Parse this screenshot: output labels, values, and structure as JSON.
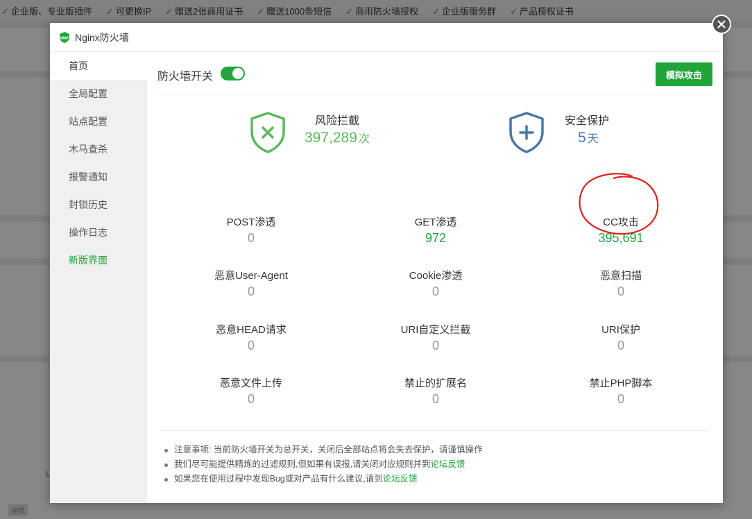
{
  "topbar": {
    "perks": [
      "企业版、专业版插件",
      "可更换IP",
      "赠送2张商用证书",
      "赠送1000条短信",
      "商用防火墙授权",
      "企业版服务群",
      "产品授权证书"
    ]
  },
  "background": {
    "side_letter": "L",
    "bottom_label": "推荐"
  },
  "modal": {
    "title": "Nginx防火墙",
    "logo_text": "WAF"
  },
  "sidebar": {
    "items": [
      {
        "label": "首页"
      },
      {
        "label": "全局配置"
      },
      {
        "label": "站点配置"
      },
      {
        "label": "木马查杀"
      },
      {
        "label": "报警通知"
      },
      {
        "label": "封锁历史"
      },
      {
        "label": "操作日志"
      },
      {
        "label": "新版界面"
      }
    ]
  },
  "toolbar": {
    "switch_label": "防火墙开关",
    "switch_on": true,
    "simulate_button": "模拟攻击"
  },
  "summary": {
    "risk": {
      "label": "风险拦截",
      "value": "397,289",
      "unit": "次"
    },
    "safe": {
      "label": "安全保护",
      "value": "5",
      "unit": "天"
    }
  },
  "stats": [
    {
      "label": "POST渗透",
      "value": "0"
    },
    {
      "label": "GET渗透",
      "value": "972"
    },
    {
      "label": "CC攻击",
      "value": "395,691"
    },
    {
      "label": "恶意User-Agent",
      "value": "0"
    },
    {
      "label": "Cookie渗透",
      "value": "0"
    },
    {
      "label": "恶意扫描",
      "value": "0"
    },
    {
      "label": "恶意HEAD请求",
      "value": "0"
    },
    {
      "label": "URI自定义拦截",
      "value": "0"
    },
    {
      "label": "URI保护",
      "value": "0"
    },
    {
      "label": "恶意文件上传",
      "value": "0"
    },
    {
      "label": "禁止的扩展名",
      "value": "0"
    },
    {
      "label": "禁止PHP脚本",
      "value": "0"
    }
  ],
  "notes": {
    "n1": "注意事项: 当前防火墙开关为总开关，关闭后全部站点将会失去保护，请谨慎操作",
    "n2": "我们尽可能提供精炼的过滤规则,但如果有误报,请关闭对应规则并到",
    "n2_link": "论坛反馈",
    "n3": "如果您在使用过程中发现Bug或对产品有什么建议,请到",
    "n3_link": "论坛反馈"
  },
  "colors": {
    "accent": "#20a53a",
    "safe_blue": "#4a78a8",
    "annotation_red": "#e02020"
  }
}
